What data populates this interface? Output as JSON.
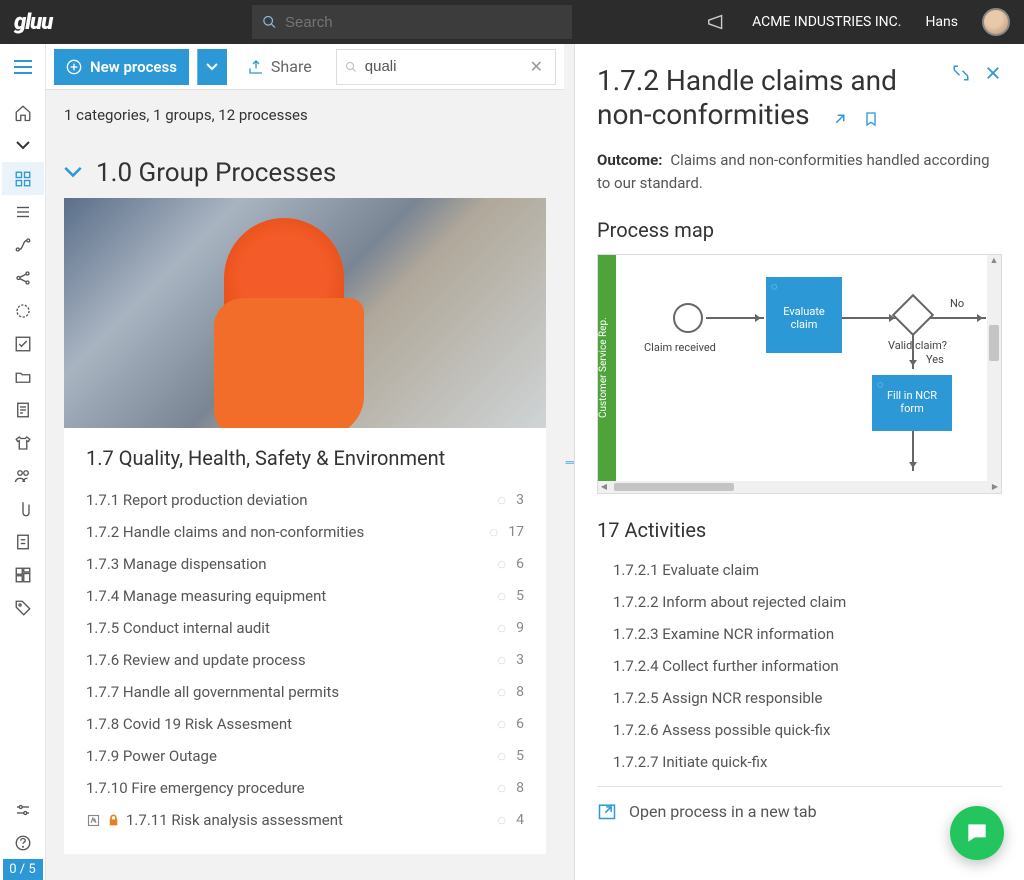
{
  "topbar": {
    "logo": "gluu",
    "search_placeholder": "Search",
    "company": "ACME INDUSTRIES INC.",
    "user": "Hans"
  },
  "toolbar": {
    "new_process": "New process",
    "share": "Share",
    "filter_value": "quali"
  },
  "breadcrumb": "1 categories, 1 groups, 12 processes",
  "group": {
    "title": "1.0 Group Processes",
    "subgroup": "1.7 Quality, Health, Safety & Environment",
    "processes": [
      {
        "label": "1.7.1 Report production deviation",
        "count": "3"
      },
      {
        "label": "1.7.2 Handle claims and non-conformities",
        "count": "17"
      },
      {
        "label": "1.7.3 Manage dispensation",
        "count": "6"
      },
      {
        "label": "1.7.4 Manage measuring equipment",
        "count": "5"
      },
      {
        "label": "1.7.5 Conduct internal audit",
        "count": "9"
      },
      {
        "label": "1.7.6 Review and update process",
        "count": "3"
      },
      {
        "label": "1.7.7 Handle all governmental permits",
        "count": "8"
      },
      {
        "label": "1.7.8 Covid 19 Risk Assesment",
        "count": "6"
      },
      {
        "label": "1.7.9 Power Outage",
        "count": "5"
      },
      {
        "label": "1.7.10 Fire emergency procedure",
        "count": "8"
      },
      {
        "label": "1.7.11 Risk analysis assessment",
        "count": "4",
        "locked": true,
        "draft": true
      }
    ]
  },
  "detail": {
    "title": "1.7.2 Handle claims and non-conformities",
    "outcome_label": "Outcome:",
    "outcome_text": "Claims and non-conformities handled according to our standard.",
    "process_map_label": "Process map",
    "swimlane": "Customer Service Rep.",
    "nodes": {
      "start": "Claim received",
      "task1": "Evaluate claim",
      "gateway": "Valid claim?",
      "no": "No",
      "yes": "Yes",
      "task2": "Fill in NCR form"
    },
    "activities_header": "17 Activities",
    "activities": [
      "1.7.2.1 Evaluate claim",
      "1.7.2.2 Inform about rejected claim",
      "1.7.2.3 Examine NCR information",
      "1.7.2.4 Collect further information",
      "1.7.2.5 Assign NCR responsible",
      "1.7.2.6 Assess possible quick-fix",
      "1.7.2.7 Initiate quick-fix"
    ],
    "open_new_tab": "Open process in a new tab"
  },
  "counter": "0 / 5"
}
